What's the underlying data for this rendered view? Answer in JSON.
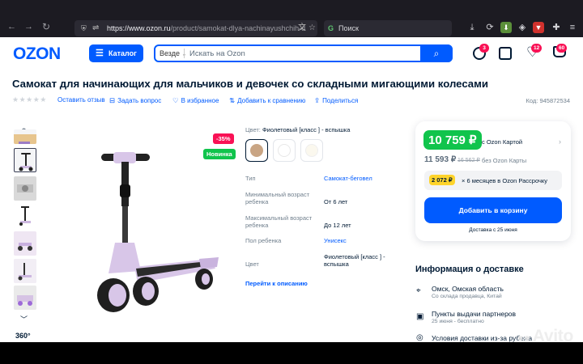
{
  "browser": {
    "back": "←",
    "forward": "→",
    "reload": "↻",
    "url_domain": "https://www.ozon.ru",
    "url_path": "/product/samokat-dlya-nachinayushchih-d",
    "search_placeholder": "Поиск"
  },
  "header": {
    "logo": "OZON",
    "catalog_label": "Каталог",
    "search_scope": "Везде",
    "search_placeholder": "Искать на Ozon",
    "badges": {
      "orders": "3",
      "favorites": "12",
      "cart": "60"
    }
  },
  "product": {
    "title": "Самокат для начинающих для мальчиков и девочек со складными мигающими колесами",
    "actions": {
      "review": "Оставить отзыв",
      "question": "Задать вопрос",
      "favorite": "В избранное",
      "compare": "Добавить к сравнению",
      "share": "Поделиться"
    },
    "code": "Код: 945872534",
    "discount": "-35%",
    "new_label": "Новинка",
    "color_label": "Цвет:",
    "color_value": "Фиолетовый [класс ] - вспышка",
    "specs": [
      {
        "key": "Тип",
        "value": "Самокат-беговел",
        "link": true
      },
      {
        "key": "Минимальный возраст ребенка",
        "value": "От 6 лет",
        "link": false
      },
      {
        "key": "Максимальный возраст ребенка",
        "value": "До 12 лет",
        "link": false
      },
      {
        "key": "Пол ребенка",
        "value": "Унисекс",
        "link": true
      },
      {
        "key": "Цвет",
        "value": "Фиолетовый [класс ] - вспышка",
        "link": false
      }
    ],
    "goto_description": "Перейти к описанию",
    "view360": "360°"
  },
  "price": {
    "card_price": "10 759 ₽",
    "card_label": "с Ozon Картой",
    "regular_price": "11 593 ₽",
    "old_price": "16 562 ₽",
    "no_card_label": "без Ozon Карты",
    "installment_amount": "2 072 ₽",
    "installment_text": "× 6 месяцев в Ozon Рассрочку",
    "add_to_cart": "Добавить в корзину",
    "delivery_date": "Доставка с 25 июня"
  },
  "delivery": {
    "header": "Информация о доставке",
    "items": [
      {
        "line1": "Омск, Омская область",
        "line2": "Со склада продавца, Китай"
      },
      {
        "line1": "Пункты выдачи партнеров",
        "line2": "25 июня - бесплатно"
      },
      {
        "line1": "Условия доставки из-за рубежа",
        "line2": ""
      }
    ]
  },
  "watermark": "Avito",
  "colors": {
    "ozon_blue": "#005bff",
    "green": "#10c44c",
    "pink": "#f91155",
    "yellow": "#fed42b",
    "scooter_lilac": "#d7c3e6"
  }
}
